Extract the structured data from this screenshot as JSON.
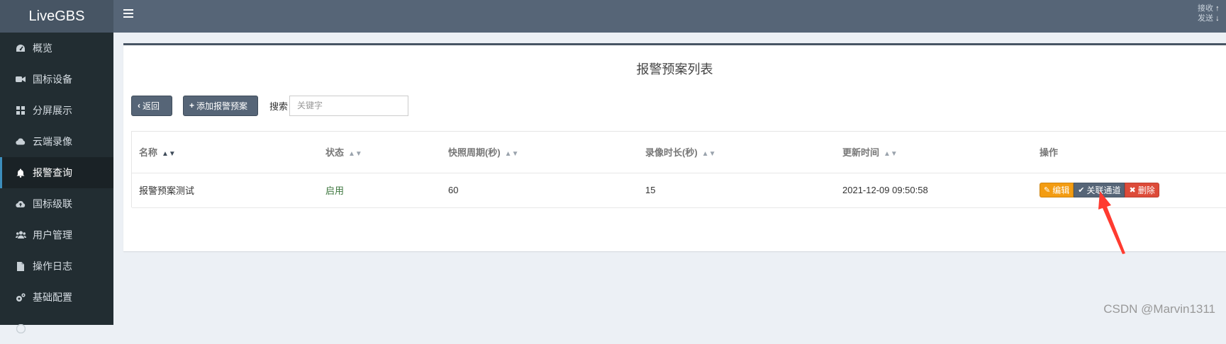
{
  "app": {
    "brand": "LiveGBS"
  },
  "topbar": {
    "recv_label": "接收",
    "send_label": "发送"
  },
  "sidebar": {
    "items": [
      {
        "label": "概览",
        "icon": "dashboard-icon"
      },
      {
        "label": "国标设备",
        "icon": "video-camera-icon"
      },
      {
        "label": "分屏展示",
        "icon": "grid-icon"
      },
      {
        "label": "云端录像",
        "icon": "cloud-icon"
      },
      {
        "label": "报警查询",
        "icon": "bell-icon",
        "active": true
      },
      {
        "label": "国标级联",
        "icon": "cloud-upload-icon"
      },
      {
        "label": "用户管理",
        "icon": "users-icon"
      },
      {
        "label": "操作日志",
        "icon": "file-icon"
      },
      {
        "label": "基础配置",
        "icon": "cogs-icon"
      }
    ]
  },
  "main": {
    "title": "报警预案列表",
    "toolbar": {
      "back_label": "返回",
      "add_label": "添加报警预案",
      "search_label": "搜索",
      "search_placeholder": "关键字"
    },
    "table": {
      "columns": [
        "名称",
        "状态",
        "快照周期(秒)",
        "录像时长(秒)",
        "更新时间",
        "操作"
      ],
      "rows": [
        {
          "name": "报警预案测试",
          "status": "启用",
          "snapshot_period": "60",
          "record_duration": "15",
          "updated_at": "2021-12-09 09:50:58",
          "actions": {
            "edit": "编辑",
            "link": "关联通道",
            "delete": "删除"
          }
        }
      ]
    }
  },
  "colors": {
    "sidebar_bg": "#222d32",
    "topbar_bg": "#566577",
    "edit_btn": "#f39c12",
    "link_btn": "#566577",
    "delete_btn": "#dd4b39",
    "status_enabled": "#3c763d",
    "annotation_arrow": "#ff3b30"
  },
  "watermark": "CSDN @Marvin1311"
}
